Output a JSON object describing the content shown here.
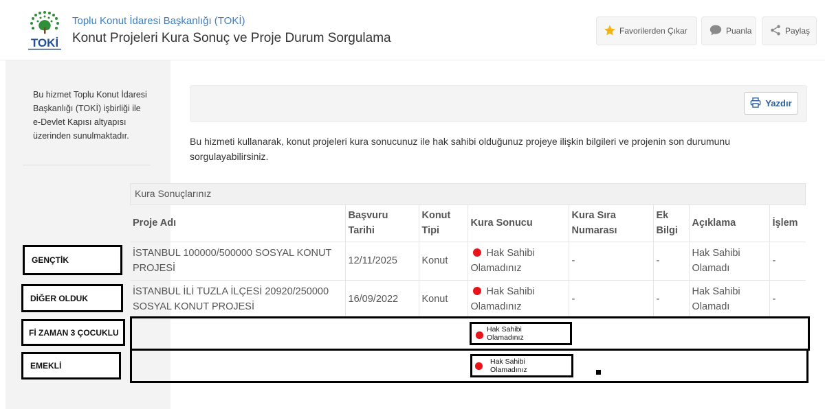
{
  "header": {
    "logo_text": "TOKİ",
    "org_name": "Toplu Konut İdaresi Başkanlığı (TOKİ)",
    "title": "Konut Projeleri Kura Sonuç ve Proje Durum Sorgulama",
    "buttons": [
      {
        "label": "Favorilerden Çıkar",
        "icon": "star-icon"
      },
      {
        "label": "Puanla",
        "icon": "speech-bubble-icon"
      },
      {
        "label": "Paylaş",
        "icon": "share-icon"
      }
    ]
  },
  "sidebar": {
    "info": "Bu hizmet Toplu Konut İdaresi Başkanlığı (TOKİ) işbirliği ile e-Devlet Kapısı altyapısı üzerinden sunulmaktadır."
  },
  "toolbar": {
    "print_label": "Yazdır",
    "print_icon": "printer-icon"
  },
  "description": "Bu hizmeti kullanarak, konut projeleri kura sonucunuz ile hak sahibi olduğunuz projeye ilişkin bilgileri ve projenin son durumunu sorgulayabilirsiniz.",
  "results": {
    "caption": "Kura Sonuçlarınız",
    "columns": [
      "Proje Adı",
      "Başvuru Tarihi",
      "Konut Tipi",
      "Kura Sonucu",
      "Kura Sıra Numarası",
      "Ek Bilgi",
      "Açıklama",
      "İşlem"
    ],
    "rows": [
      {
        "project": "İSTANBUL 100000/500000 SOSYAL KONUT PROJESİ",
        "date": "12/11/2025",
        "type": "Konut",
        "result": "Hak Sahibi Olamadınız",
        "order_no": "-",
        "extra": "-",
        "note": "Hak Sahibi Olamadı",
        "action": "-"
      },
      {
        "project": "İSTANBUL İLİ TUZLA İLÇESİ 20920/250000 SOSYAL KONUT PROJESİ",
        "date": "16/09/2022",
        "type": "Konut",
        "result": "Hak Sahibi Olamadınız",
        "order_no": "-",
        "extra": "-",
        "note": "Hak Sahibi Olamadı",
        "action": "-"
      }
    ]
  },
  "annotations": {
    "labels": [
      "GENÇTİK",
      "DİĞER OLDUK",
      "Fİ ZAMAN 3 ÇOCUKLU",
      "EMEKLİ"
    ],
    "extra_results": [
      "Hak Sahibi Olamadınız",
      "Hak Sahibi Olamadınız"
    ]
  },
  "colors": {
    "accent_blue": "#3b7fc4",
    "result_red": "#e8141b",
    "star_yellow": "#f2b318"
  }
}
